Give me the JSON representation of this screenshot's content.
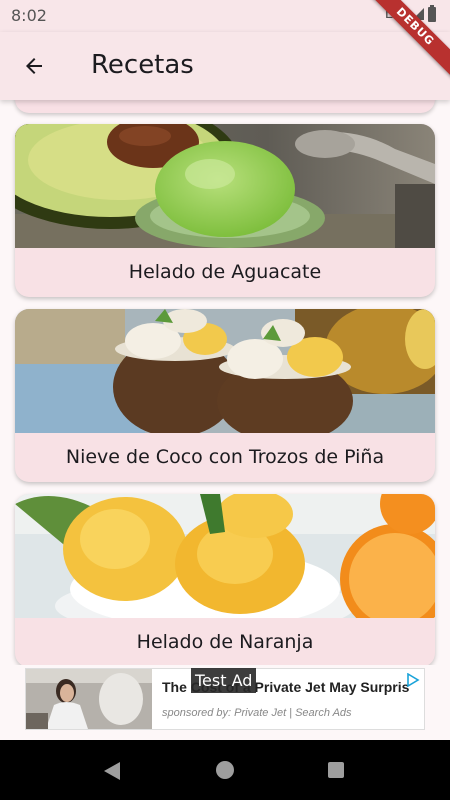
{
  "status_bar": {
    "time": "8:02",
    "network": "LTE"
  },
  "debug_banner": "DEBUG",
  "app_bar": {
    "title": "Recetas",
    "back_icon": "arrow-left-icon"
  },
  "recipes": [
    {
      "title": "Helado de Aguacate"
    },
    {
      "title": "Nieve de Coco con Trozos de Piña"
    },
    {
      "title": "Helado de Naranja"
    }
  ],
  "ad": {
    "label": "Test Ad",
    "headline": "The Cost of a Private Jet May Surpris",
    "sponsor": "sponsored by: Private Jet | Search Ads"
  },
  "nav_bar": {
    "icons": [
      "back-triangle-icon",
      "home-circle-icon",
      "recents-square-icon"
    ]
  }
}
